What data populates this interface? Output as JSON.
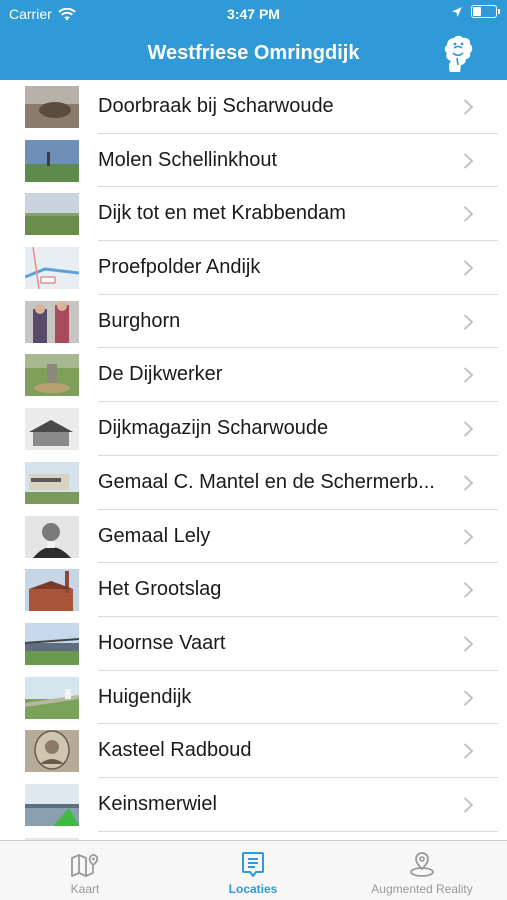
{
  "status": {
    "carrier": "Carrier",
    "time": "3:47 PM",
    "battery_level": 0.4
  },
  "nav": {
    "title": "Westfriese Omringdijk",
    "logo_icon": "westfriese-logo-icon"
  },
  "locations": [
    {
      "label": "Doorbraak bij Scharwoude"
    },
    {
      "label": "Molen Schellinkhout"
    },
    {
      "label": "Dijk tot en met Krabbendam"
    },
    {
      "label": "Proefpolder Andijk"
    },
    {
      "label": "Burghorn"
    },
    {
      "label": "De Dijkwerker"
    },
    {
      "label": "Dijkmagazijn Scharwoude"
    },
    {
      "label": "Gemaal C. Mantel en de Schermerb..."
    },
    {
      "label": "Gemaal Lely"
    },
    {
      "label": "Het Grootslag"
    },
    {
      "label": "Hoornse Vaart"
    },
    {
      "label": "Huigendijk"
    },
    {
      "label": "Kasteel Radboud"
    },
    {
      "label": "Keinsmerwiel"
    },
    {
      "label": ""
    }
  ],
  "tabs": [
    {
      "label": "Kaart",
      "icon": "map-icon"
    },
    {
      "label": "Locaties",
      "icon": "list-icon"
    },
    {
      "label": "Augmented Reality",
      "icon": "location-pin-icon"
    }
  ],
  "colors": {
    "accent": "#2f9ad7",
    "inactive": "#9a9a9a"
  }
}
